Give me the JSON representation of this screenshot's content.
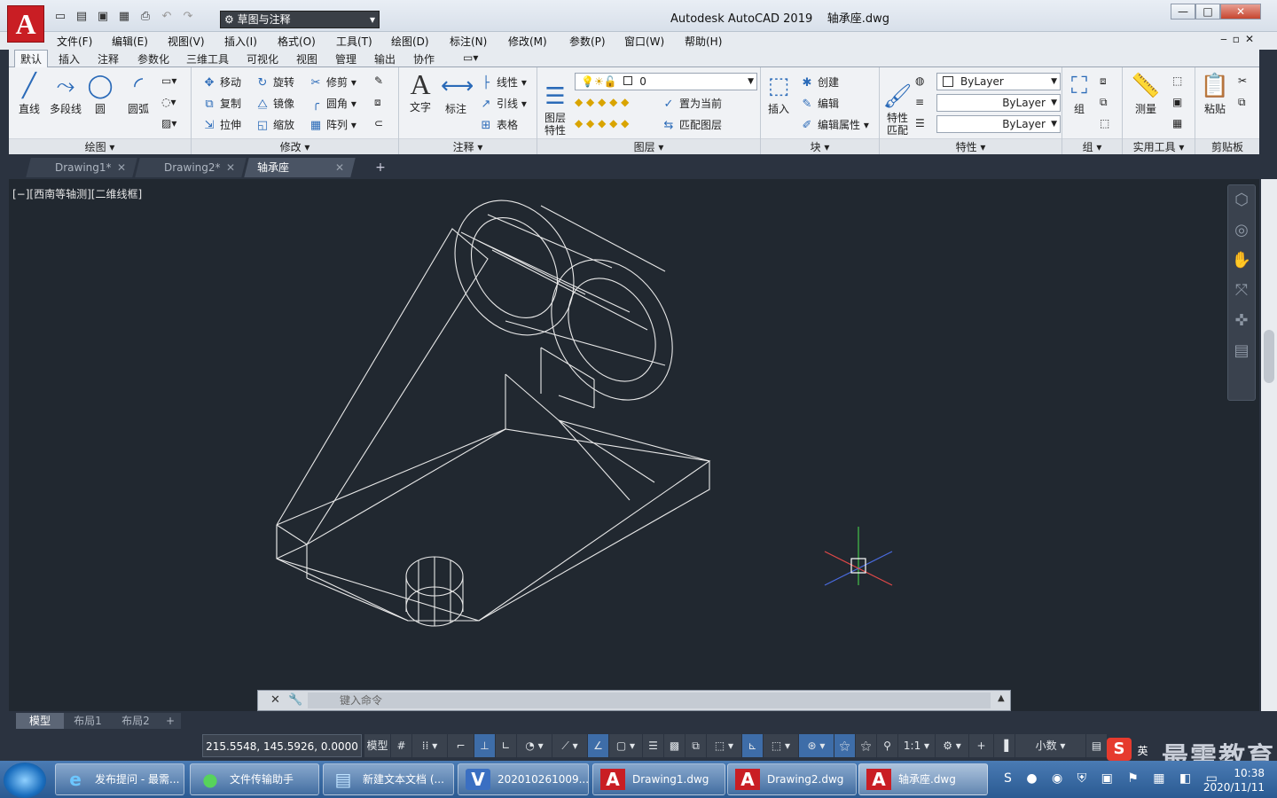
{
  "app": {
    "logo_letter": "A",
    "title": "Autodesk AutoCAD 2019",
    "file": "轴承座.dwg",
    "workspace": "草图与注释",
    "window_controls": [
      "—",
      "□",
      "✕"
    ]
  },
  "menus": [
    "文件(F)",
    "编辑(E)",
    "视图(V)",
    "插入(I)",
    "格式(O)",
    "工具(T)",
    "绘图(D)",
    "标注(N)",
    "修改(M)",
    "参数(P)",
    "窗口(W)",
    "帮助(H)"
  ],
  "ribbon_tabs": [
    "默认",
    "插入",
    "注释",
    "参数化",
    "三维工具",
    "可视化",
    "视图",
    "管理",
    "输出",
    "协作"
  ],
  "ribbon": {
    "draw": {
      "title": "绘图",
      "line": "直线",
      "polyline": "多段线",
      "circle": "圆",
      "arc": "圆弧"
    },
    "modify": {
      "title": "修改",
      "move": "移动",
      "rotate": "旋转",
      "trim": "修剪",
      "copy": "复制",
      "mirror": "镜像",
      "fillet": "圆角",
      "stretch": "拉伸",
      "scale": "缩放",
      "array": "阵列"
    },
    "annotate": {
      "title": "注释",
      "text": "文字",
      "dimension": "标注",
      "linear": "线性",
      "leader": "引线",
      "table": "表格"
    },
    "layers": {
      "title": "图层",
      "props": "图层\n特性",
      "current_layer": "0",
      "set_current": "置为当前",
      "match_layer": "匹配图层"
    },
    "block": {
      "title": "块",
      "insert": "插入",
      "create": "创建",
      "edit": "编辑",
      "edit_attr": "编辑属性"
    },
    "properties": {
      "title": "特性",
      "match": "特性\n匹配",
      "color": "ByLayer",
      "linetype": "ByLayer",
      "lineweight": "ByLayer"
    },
    "group": {
      "title": "组",
      "group": "组"
    },
    "utilities": {
      "title": "实用工具",
      "measure": "测量"
    },
    "clipboard": {
      "title": "剪贴板",
      "paste": "粘贴"
    }
  },
  "doc_tabs": [
    {
      "label": "Drawing1*",
      "active": false
    },
    {
      "label": "Drawing2*",
      "active": false
    },
    {
      "label": "轴承座",
      "active": true
    }
  ],
  "viewport_label": "[−][西南等轴测][二维线框]",
  "command_placeholder": "键入命令",
  "layout_tabs": [
    "模型",
    "布局1",
    "布局2"
  ],
  "status": {
    "coords": "215.5548, 145.5926, 0.0000",
    "model": "模型",
    "scale": "1:1",
    "units": "小数"
  },
  "taskbar": [
    {
      "label": "发布提问 - 最需...",
      "icon": "ie-icon"
    },
    {
      "label": "文件传输助手",
      "icon": "wechat-icon"
    },
    {
      "label": "新建文本文档 (...",
      "icon": "notepad-icon"
    },
    {
      "label": "202010261009...",
      "icon": "visio-icon"
    },
    {
      "label": "Drawing1.dwg",
      "icon": "autocad-icon"
    },
    {
      "label": "Drawing2.dwg",
      "icon": "autocad-icon"
    },
    {
      "label": "轴承座.dwg",
      "icon": "autocad-icon"
    }
  ],
  "clock": {
    "time": "10:38",
    "date": "2020/11/11"
  },
  "watermark": "最需教育",
  "ime": "英",
  "colors": {
    "canvas_bg": "#212830",
    "accent": "#c91e24",
    "wire": "#e8e8e8"
  }
}
